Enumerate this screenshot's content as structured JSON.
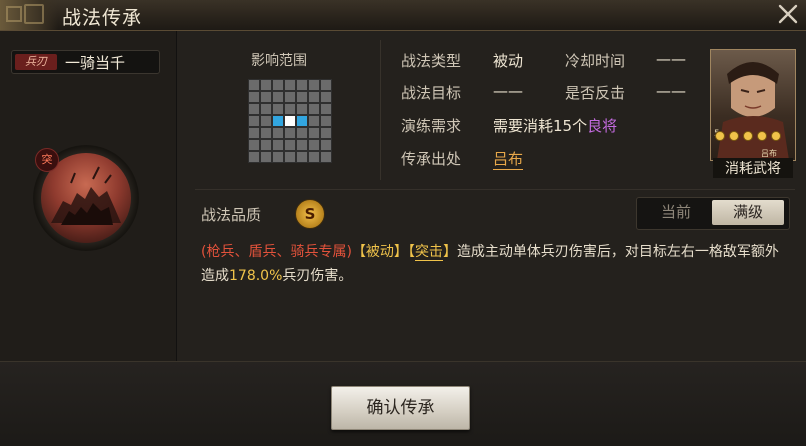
{
  "window": {
    "title": "战法传承",
    "close_icon": "close-icon"
  },
  "skill": {
    "type_tag": "兵刃",
    "name": "一骑当千",
    "icon_tag": "突",
    "icon": "cavalry-charge-icon"
  },
  "range": {
    "label": "影响范围",
    "grid_size": 7,
    "self_cell": [
      3,
      3
    ],
    "target_cells": [
      [
        3,
        2
      ],
      [
        3,
        4
      ]
    ]
  },
  "info": {
    "type_label": "战法类型",
    "type_value": "被动",
    "cooldown_label": "冷却时间",
    "cooldown_value": "——",
    "target_label": "战法目标",
    "target_value": "——",
    "counter_label": "是否反击",
    "counter_value": "——",
    "practice_label": "演练需求",
    "practice_prefix": "需要消耗",
    "practice_count": "15个",
    "practice_item": "良将",
    "origin_label": "传承出处",
    "origin_value": "吕布"
  },
  "portrait": {
    "caption": "消耗武将",
    "stars": 5,
    "star_icon": "star-icon",
    "level": "5",
    "name": "吕布"
  },
  "quality": {
    "label": "战法品质",
    "grade": "S"
  },
  "level_toggle": {
    "current": "当前",
    "max": "满级",
    "selected": "max"
  },
  "description": {
    "troops": "(枪兵、盾兵、骑兵专属)",
    "tag1": "【被动】",
    "tag2_open": "【",
    "tag2_word": "突击",
    "tag2_close": "】",
    "text1": "造成主动单体兵刃伤害后，对目标左右一格敌军额外造成",
    "percent": "178.0%",
    "text2": "兵刃伤害。"
  },
  "footer": {
    "confirm_label": "确认传承"
  },
  "colors": {
    "accent_gold": "#f0c34a",
    "troop_red": "#e2523b",
    "rarity_purple": "#c46be0",
    "grid_self": "#ffffff",
    "grid_target": "#32a6e0"
  }
}
